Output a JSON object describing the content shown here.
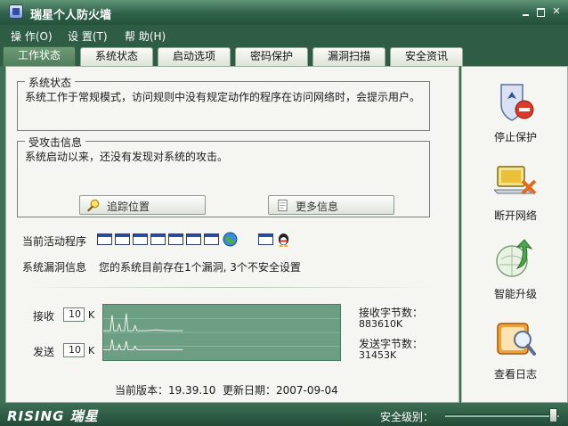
{
  "window": {
    "title": "瑞星个人防火墙"
  },
  "menu": [
    "操 作(O)",
    "设 置(T)",
    "帮 助(H)"
  ],
  "tabs": [
    "工作状态",
    "系统状态",
    "启动选项",
    "密码保护",
    "漏洞扫描",
    "安全资讯"
  ],
  "active_tab": 0,
  "system_status": {
    "title": "系统状态",
    "text": "系统工作于常规模式，访问规则中没有规定动作的程序在访问网络时，会提示用户。"
  },
  "attack_info": {
    "title": "受攻击信息",
    "text": "系统启动以来，还没有发现对系统的攻击。",
    "trace_button": "追踪位置",
    "more_button": "更多信息"
  },
  "active_programs": {
    "label": "当前活动程序"
  },
  "vulnerability": {
    "label": "系统漏洞信息",
    "text": "您的系统目前存在1个漏洞, 3个不安全设置"
  },
  "traffic": {
    "receive_label": "接收",
    "receive_value": "10",
    "send_label": "发送",
    "send_value": "10",
    "unit": "K",
    "received_bytes_label": "接收字节数：",
    "received_bytes_value": "883610K",
    "sent_bytes_label": "发送字节数：",
    "sent_bytes_value": "31453K"
  },
  "version": {
    "label": "当前版本：19.39.10",
    "date": "更新日期：2007-09-04"
  },
  "actions": [
    "停止保护",
    "断开网络",
    "智能升级",
    "查看日志"
  ],
  "status_bar": {
    "brand": "RISING 瑞星",
    "security_label": "安全级别："
  },
  "colors": {
    "frame": "#2e5c45",
    "panel": "#f5f6f1",
    "graph": "#6c9e83"
  }
}
